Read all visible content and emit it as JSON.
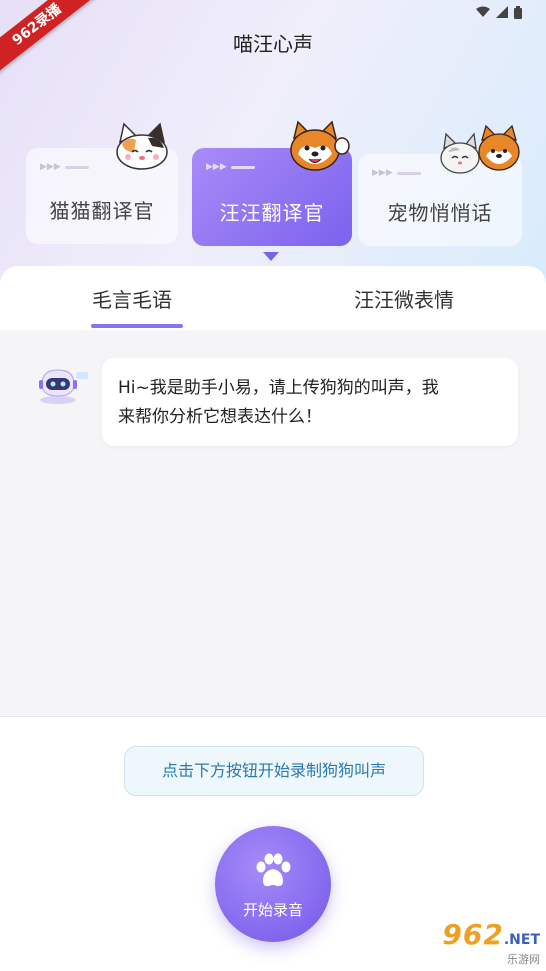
{
  "status": {
    "icons": [
      "wifi-icon",
      "signal-icon",
      "battery-icon"
    ]
  },
  "watermark_ribbon": "962录播",
  "header": {
    "title": "喵汪心声"
  },
  "cards": [
    {
      "label": "猫猫翻译官",
      "selected": false,
      "animal": "cat-icon"
    },
    {
      "label": "汪汪翻译官",
      "selected": true,
      "animal": "dog-icon"
    },
    {
      "label": "宠物悄悄话",
      "selected": false,
      "animal": "cat-dog-icon"
    }
  ],
  "tabs": [
    {
      "label": "毛言毛语",
      "active": true
    },
    {
      "label": "汪汪微表情",
      "active": false
    }
  ],
  "chat": {
    "avatar": "robot-assistant-icon",
    "messages": [
      {
        "line1": "Hi~我是助手小易，请上传狗狗的叫声，我",
        "line2": "来帮你分析它想表达什么！"
      }
    ]
  },
  "hint": {
    "text": "点击下方按钮开始录制狗狗叫声"
  },
  "record_button": {
    "label": "开始录音",
    "icon": "paw-icon"
  },
  "watermark": {
    "main": "962",
    "suffix": ".NET",
    "sub": "乐游网"
  },
  "colors": {
    "accent": "#8a6ff1",
    "hint_text": "#2a7ab0",
    "hint_bg": "#eef7fb"
  }
}
